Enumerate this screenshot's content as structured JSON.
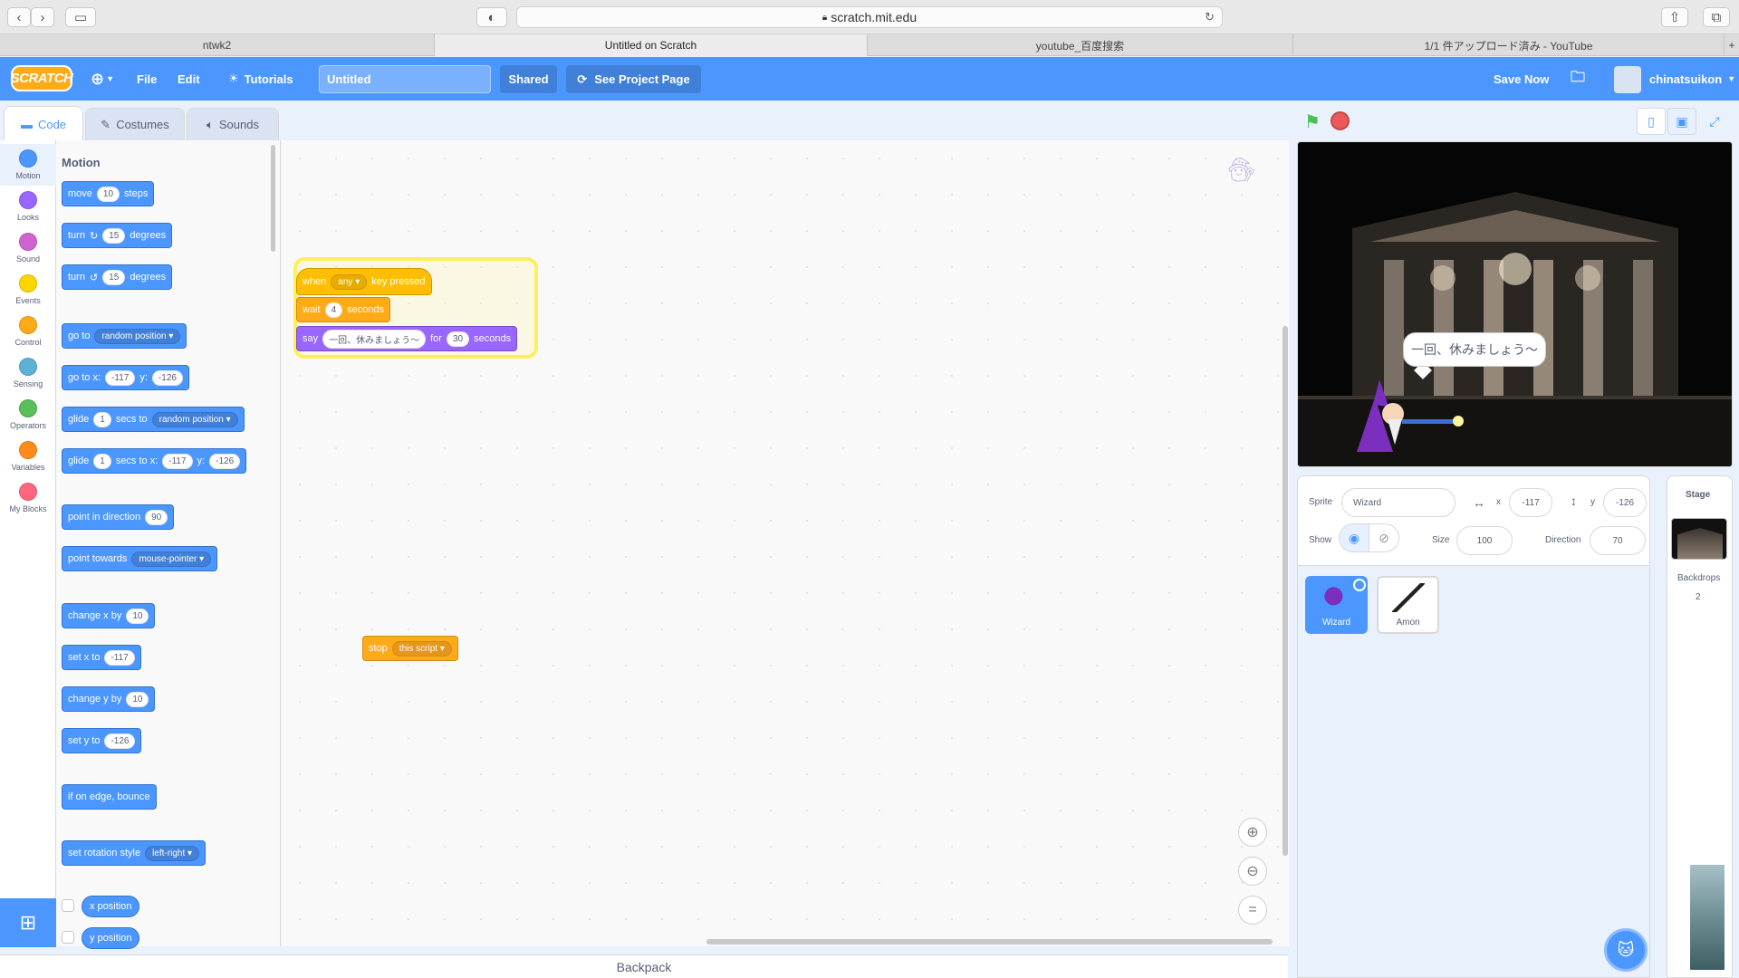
{
  "browser": {
    "url": "scratch.mit.edu",
    "tabs": [
      "ntwk2",
      "Untitled on Scratch",
      "youtube_百度搜索",
      "1/1 件アップロード済み - YouTube"
    ],
    "new_tab_icon": "plus-icon"
  },
  "menu": {
    "logo": "SCRATCH",
    "language_icon": "globe-icon",
    "file": "File",
    "edit": "Edit",
    "tutorials": "Tutorials",
    "project_title": "Untitled",
    "shared": "Shared",
    "see_project_page": "See Project Page",
    "save_now": "Save Now",
    "username": "chinatsuikon"
  },
  "editor_tabs": [
    "Code",
    "Costumes",
    "Sounds"
  ],
  "categories": [
    {
      "label": "Motion",
      "color": "#4c97ff"
    },
    {
      "label": "Looks",
      "color": "#9966ff"
    },
    {
      "label": "Sound",
      "color": "#cf63cf"
    },
    {
      "label": "Events",
      "color": "#ffd500"
    },
    {
      "label": "Control",
      "color": "#ffab19"
    },
    {
      "label": "Sensing",
      "color": "#5cb1d6"
    },
    {
      "label": "Operators",
      "color": "#59c059"
    },
    {
      "label": "Variables",
      "color": "#ff8c1a"
    },
    {
      "label": "My Blocks",
      "color": "#ff6680"
    }
  ],
  "palette": {
    "title": "Motion",
    "move": {
      "a": "move",
      "v": "10",
      "b": "steps"
    },
    "turn_right": {
      "a": "turn",
      "v": "15",
      "b": "degrees"
    },
    "turn_left": {
      "a": "turn",
      "v": "15",
      "b": "degrees"
    },
    "goto": {
      "a": "go to",
      "dd": "random position"
    },
    "goto_xy": {
      "a": "go to x:",
      "x": "-117",
      "b": "y:",
      "y": "-126"
    },
    "glide_to": {
      "a": "glide",
      "v": "1",
      "b": "secs to",
      "dd": "random position"
    },
    "glide_xy": {
      "a": "glide",
      "v": "1",
      "b": "secs to x:",
      "x": "-117",
      "c": "y:",
      "y": "-126"
    },
    "point_dir": {
      "a": "point in direction",
      "v": "90"
    },
    "point_towards": {
      "a": "point towards",
      "dd": "mouse-pointer"
    },
    "change_x": {
      "a": "change x by",
      "v": "10"
    },
    "set_x": {
      "a": "set x to",
      "v": "-117"
    },
    "change_y": {
      "a": "change y by",
      "v": "10"
    },
    "set_y": {
      "a": "set y to",
      "v": "-126"
    },
    "bounce": "if on edge, bounce",
    "rotation": {
      "a": "set rotation style",
      "dd": "left-right"
    },
    "xpos": "x position",
    "ypos": "y position"
  },
  "script": {
    "hat": {
      "a": "when",
      "dd": "any",
      "b": "key pressed"
    },
    "wait": {
      "a": "wait",
      "v": "4",
      "b": "seconds"
    },
    "say": {
      "a": "say",
      "text": "一回、休みましょう〜",
      "b": "for",
      "v": "30",
      "c": "seconds"
    },
    "stop": {
      "a": "stop",
      "dd": "this script"
    }
  },
  "backpack": "Backpack",
  "stage": {
    "bubble": "一回、休みましょう〜"
  },
  "sprite_info": {
    "sprite_label": "Sprite",
    "sprite_name": "Wizard",
    "x_label": "x",
    "x": "-117",
    "y_label": "y",
    "y": "-126",
    "show_label": "Show",
    "size_label": "Size",
    "size": "100",
    "direction_label": "Direction",
    "direction": "70"
  },
  "sprites": [
    "Wizard",
    "Amon"
  ],
  "stage_panel": {
    "title": "Stage",
    "backdrops_label": "Backdrops",
    "backdrops_count": "2"
  }
}
